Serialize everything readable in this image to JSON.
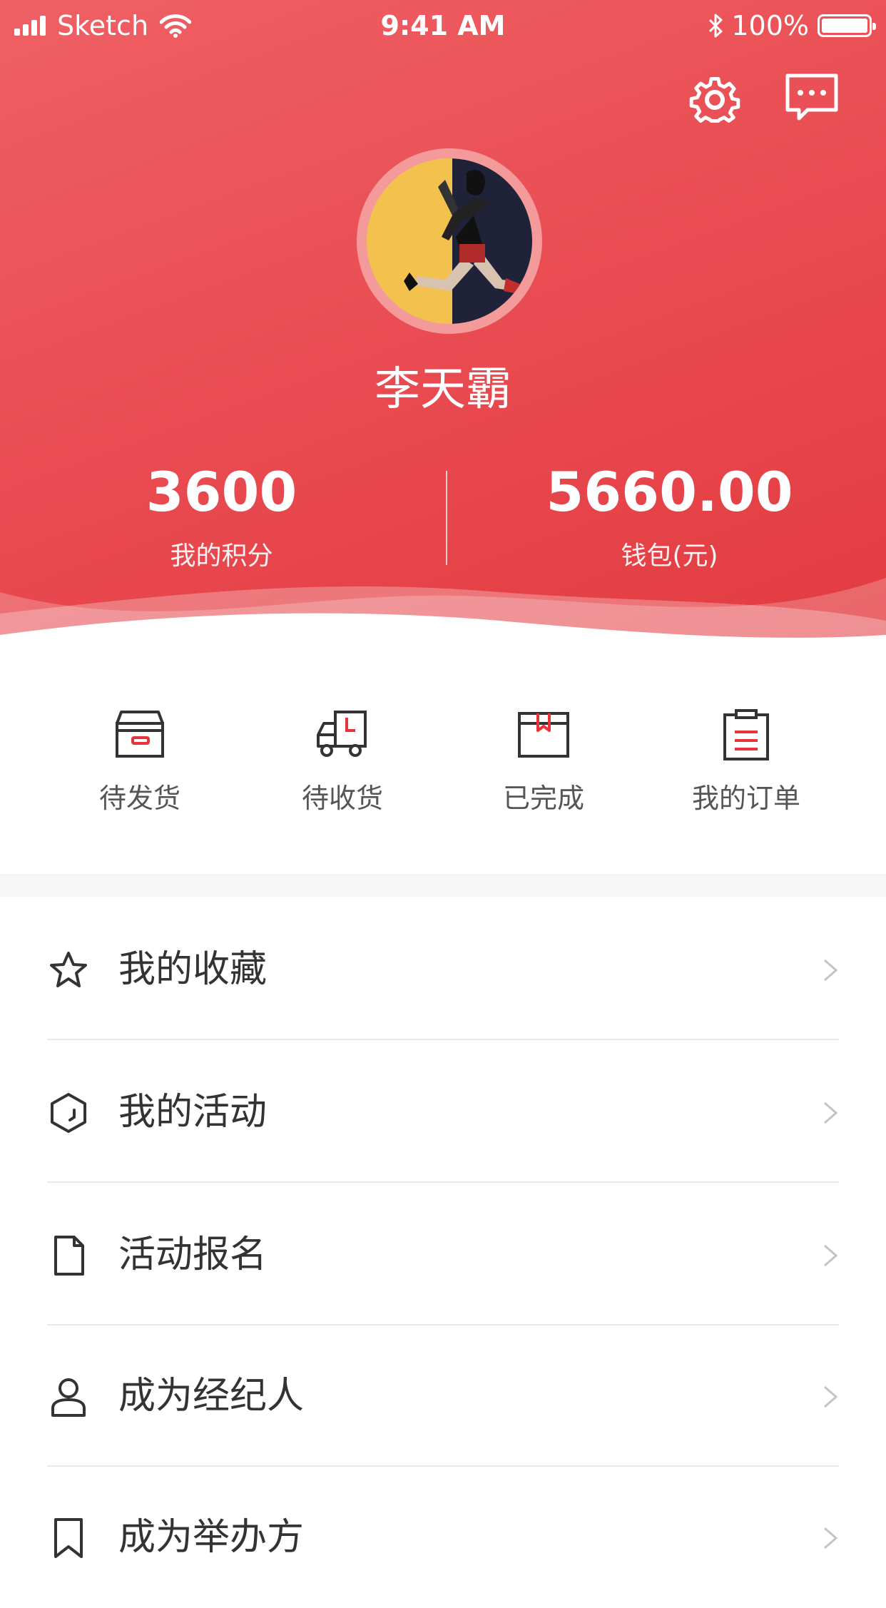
{
  "status_bar": {
    "carrier": "Sketch",
    "time": "9:41 AM",
    "battery": "100%"
  },
  "header": {
    "settings_icon": "gear-icon",
    "message_icon": "chat-bubble-icon",
    "username": "李天霸",
    "stats": [
      {
        "value": "3600",
        "label": "我的积分"
      },
      {
        "value": "5660.00",
        "label": "钱包(元)"
      }
    ]
  },
  "orders": [
    {
      "label": "待发货",
      "icon": "box-icon"
    },
    {
      "label": "待收货",
      "icon": "truck-icon"
    },
    {
      "label": "已完成",
      "icon": "package-done-icon"
    },
    {
      "label": "我的订单",
      "icon": "clipboard-icon"
    }
  ],
  "menu": [
    {
      "label": "我的收藏",
      "icon": "star-icon"
    },
    {
      "label": "我的活动",
      "icon": "hexagon-icon"
    },
    {
      "label": "活动报名",
      "icon": "document-icon"
    },
    {
      "label": "成为经纪人",
      "icon": "user-icon"
    },
    {
      "label": "成为举办方",
      "icon": "bookmark-icon"
    }
  ],
  "colors": {
    "primary": "#e84a50",
    "accent_icon": "#e8333a",
    "text": "#333333"
  }
}
